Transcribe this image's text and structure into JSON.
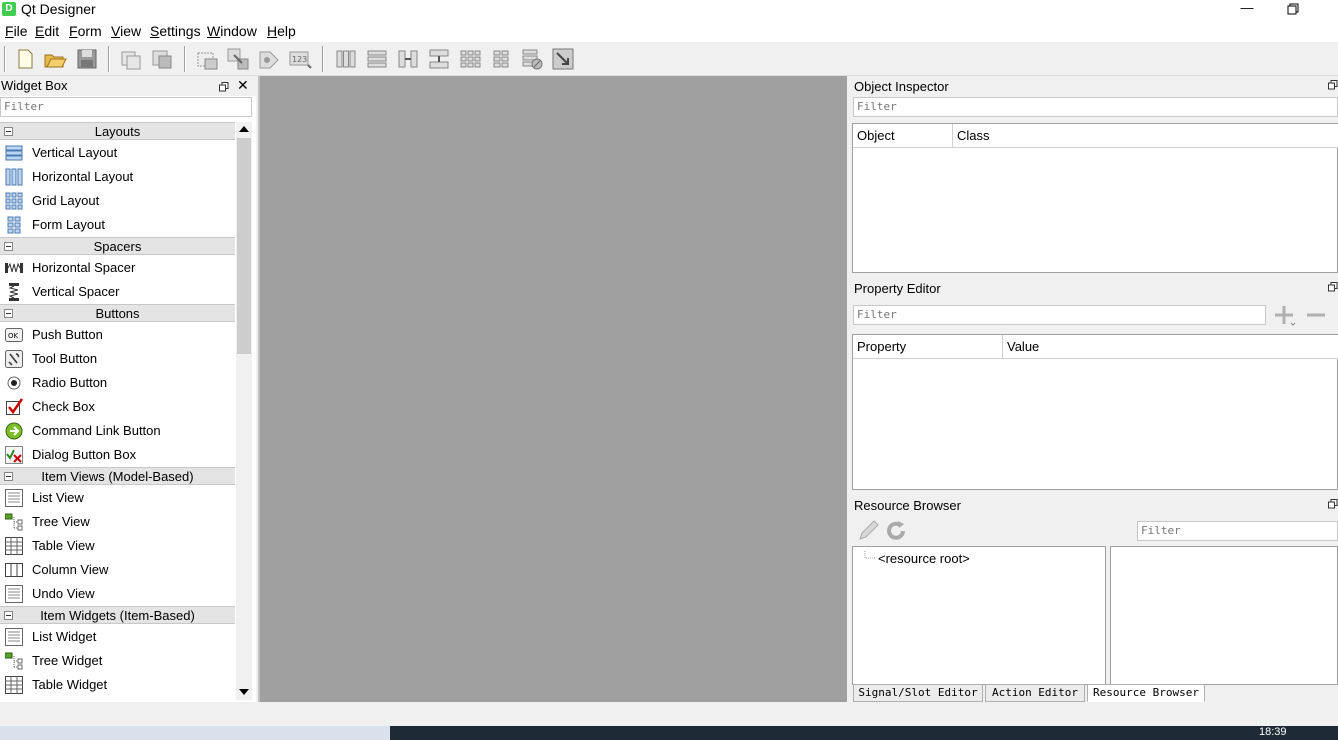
{
  "window": {
    "title": "Qt Designer",
    "icon_text": "D"
  },
  "menu": [
    {
      "label": "File",
      "u": "F",
      "rest": "ile"
    },
    {
      "label": "Edit",
      "u": "E",
      "rest": "dit"
    },
    {
      "label": "Form",
      "u": "F",
      "rest": "orm"
    },
    {
      "label": "View",
      "u": "V",
      "rest": "iew"
    },
    {
      "label": "Settings",
      "u": "S",
      "rest": "ettings"
    },
    {
      "label": "Window",
      "u": "W",
      "rest": "indow"
    },
    {
      "label": "Help",
      "u": "H",
      "rest": "elp"
    }
  ],
  "widget_box": {
    "title": "Widget Box",
    "filter_placeholder": "Filter",
    "categories": {
      "layouts": "Layouts",
      "spacers": "Spacers",
      "buttons": "Buttons",
      "item_views": "Item Views (Model-Based)",
      "item_widgets": "Item Widgets (Item-Based)"
    },
    "items": {
      "vertical_layout": "Vertical Layout",
      "horizontal_layout": "Horizontal Layout",
      "grid_layout": "Grid Layout",
      "form_layout": "Form Layout",
      "horizontal_spacer": "Horizontal Spacer",
      "vertical_spacer": "Vertical Spacer",
      "push_button": "Push Button",
      "tool_button": "Tool Button",
      "radio_button": "Radio Button",
      "check_box": "Check Box",
      "command_link_button": "Command Link Button",
      "dialog_button_box": "Dialog Button Box",
      "list_view": "List View",
      "tree_view": "Tree View",
      "table_view": "Table View",
      "column_view": "Column View",
      "undo_view": "Undo View",
      "list_widget": "List Widget",
      "tree_widget": "Tree Widget",
      "table_widget": "Table Widget"
    }
  },
  "object_inspector": {
    "title": "Object Inspector",
    "filter_placeholder": "Filter",
    "columns": [
      "Object",
      "Class"
    ]
  },
  "property_editor": {
    "title": "Property Editor",
    "filter_placeholder": "Filter",
    "columns": [
      "Property",
      "Value"
    ]
  },
  "resource_browser": {
    "title": "Resource Browser",
    "filter_placeholder": "Filter",
    "root": "<resource root>"
  },
  "bottom_tabs": [
    "Signal/Slot Editor",
    "Action Editor",
    "Resource Browser"
  ],
  "taskbar": {
    "time": "18:39"
  },
  "colors": {
    "central_bg": "#a0a0a0",
    "qt_green": "#41cd52"
  }
}
